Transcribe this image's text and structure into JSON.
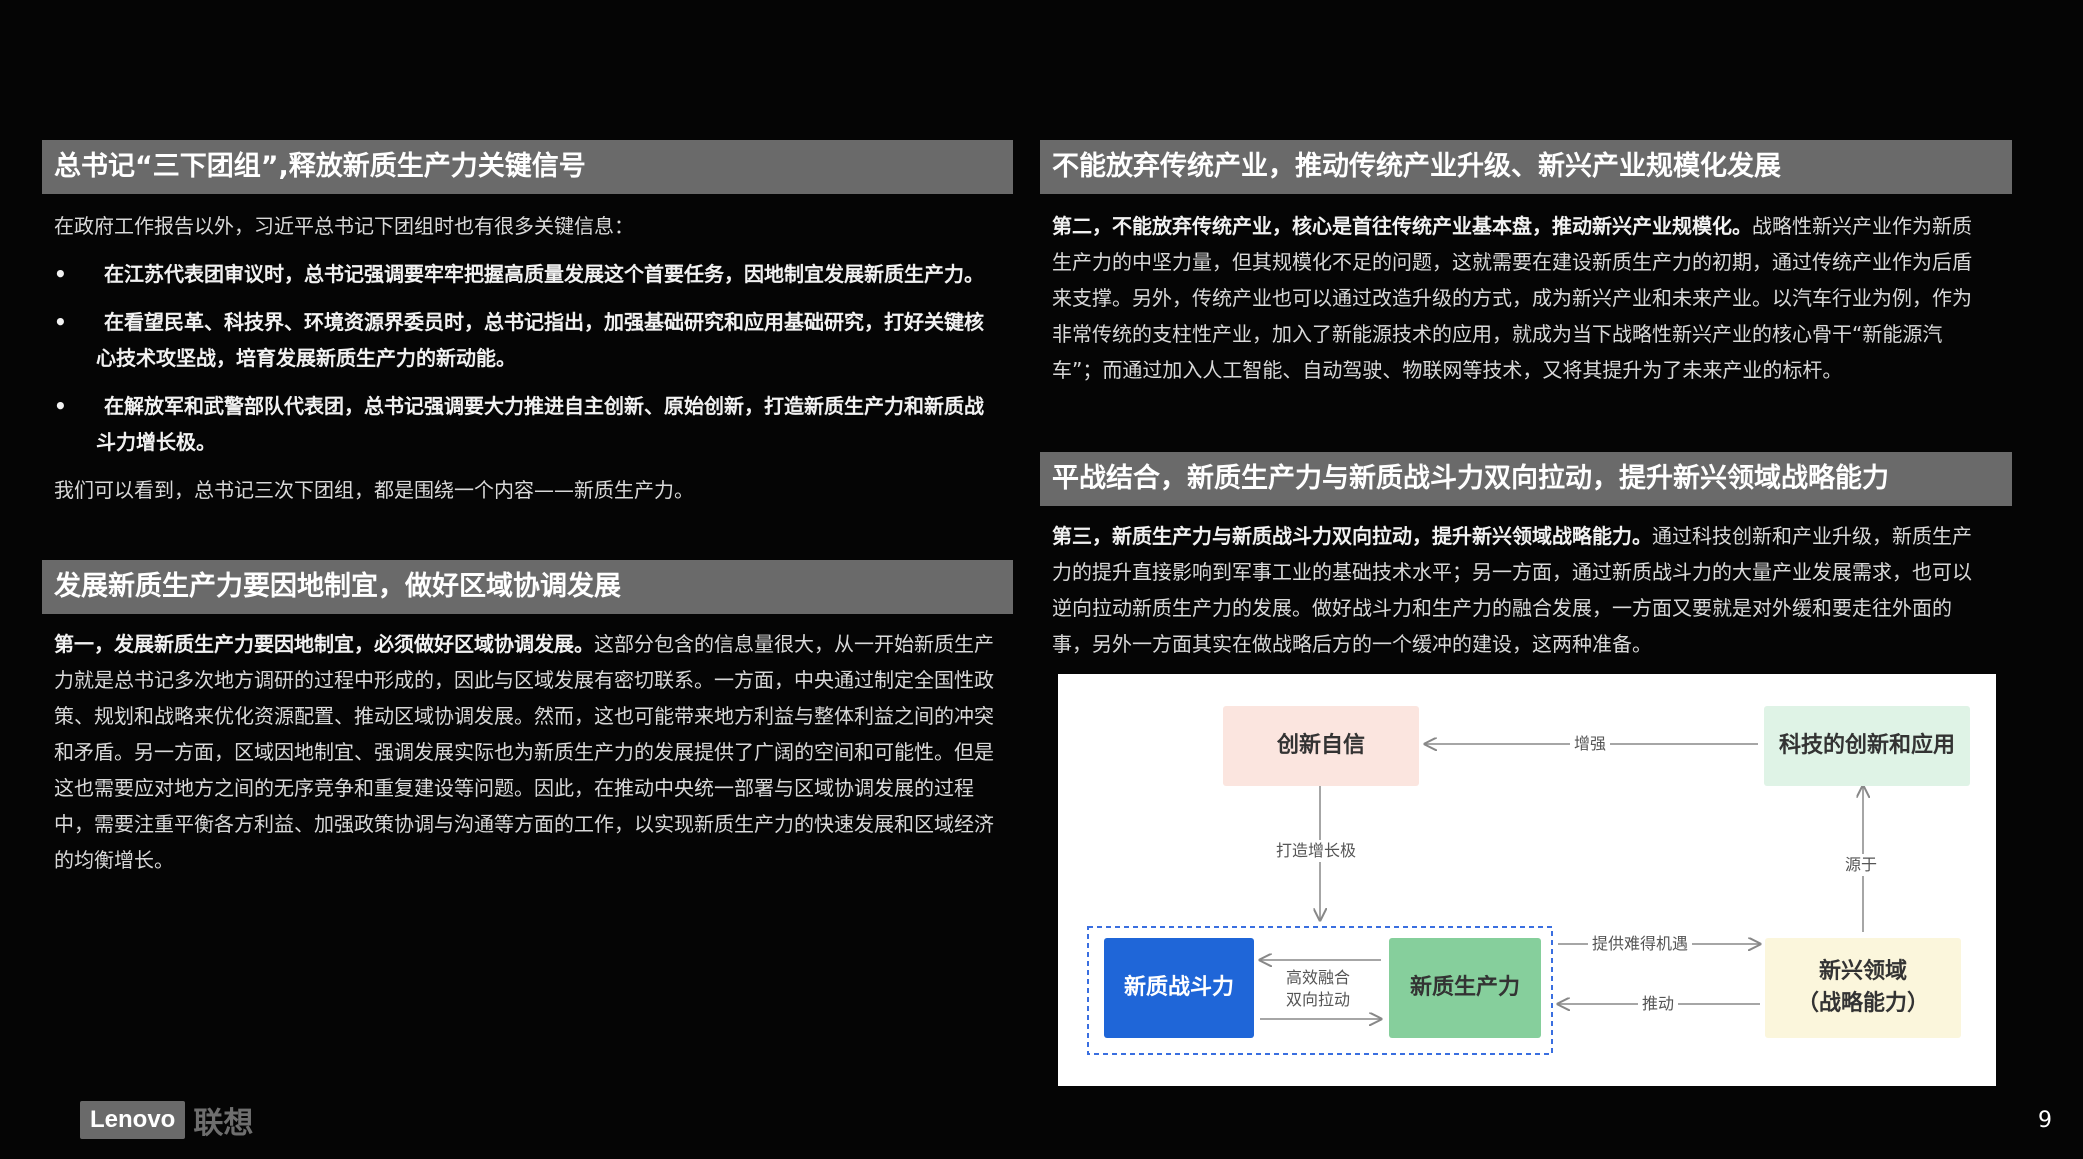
{
  "left_top": {
    "title": "总书记“三下团组”,释放新质生产力关键信号",
    "intro": "在政府工作报告以外，习近平总书记下团组时也有很多关键信息：",
    "bullets": [
      "在江苏代表团审议时，总书记强调要牢牢把握高质量发展这个首要任务，因地制宜发展新质生产力。",
      "在看望民革、科技界、环境资源界委员时，总书记指出，加强基础研究和应用基础研究，打好关键核心技术攻坚战，培育发展新质生产力的新动能。",
      "在解放军和武警部队代表团，总书记强调要大力推进自主创新、原始创新，打造新质生产力和新质战斗力增长极。"
    ],
    "bullet_symbol": "•",
    "conclusion": "我们可以看到，总书记三次下团组，都是围绕一个内容——新质生产力。"
  },
  "left_bottom": {
    "title": "发展新质生产力要因地制宜，做好区域协调发展",
    "lead_bold": "第一，发展新质生产力要因地制宜，必须做好区域协调发展。",
    "body": "这部分包含的信息量很大，从一开始新质生产力就是总书记多次地方调研的过程中形成的，因此与区域发展有密切联系。一方面，中央通过制定全国性政策、规划和战略来优化资源配置、推动区域协调发展。然而，这也可能带来地方利益与整体利益之间的冲突和矛盾。另一方面，区域因地制宜、强调发展实际也为新质生产力的发展提供了广阔的空间和可能性。但是这也需要应对地方之间的无序竞争和重复建设等问题。因此，在推动中央统一部署与区域协调发展的过程中，需要注重平衡各方利益、加强政策协调与沟通等方面的工作，以实现新质生产力的快速发展和区域经济的均衡增长。"
  },
  "right_top": {
    "title": "不能放弃传统产业，推动传统产业升级、新兴产业规模化发展",
    "lead_bold": "第二，不能放弃传统产业，核心是首往传统产业基本盘，推动新兴产业规模化。",
    "body": "战略性新兴产业作为新质生产力的中坚力量，但其规模化不足的问题，这就需要在建设新质生产力的初期，通过传统产业作为后盾来支撑。另外，传统产业也可以通过改造升级的方式，成为新兴产业和未来产业。以汽车行业为例，作为非常传统的支柱性产业，加入了新能源技术的应用，就成为当下战略性新兴产业的核心骨干“新能源汽车”；而通过加入人工智能、自动驾驶、物联网等技术，又将其提升为了未来产业的标杆。"
  },
  "right_bottom": {
    "title": "平战结合，新质生产力与新质战斗力双向拉动，提升新兴领域战略能力",
    "lead_bold": "第三，新质生产力与新质战斗力双向拉动，提升新兴领域战略能力。",
    "body": "通过科技创新和产业升级，新质生产力的提升直接影响到军事工业的基础技术水平；另一方面，通过新质战斗力的大量产业发展需求，也可以逆向拉动新质生产力的发展。做好战斗力和生产力的融合发展，一方面又要就是对外缓和要走往外面的事，另外一方面其实在做战略后方的一个缓冲的建设，这两种准备。"
  },
  "diagram": {
    "nodes": {
      "innovation_confidence": "创新自信",
      "tech_innovation": "科技的创新和应用",
      "new_combat": "新质战斗力",
      "new_productivity": "新质生产力",
      "emerging_line1": "新兴领域",
      "emerging_line2": "（战略能力）"
    },
    "edges": {
      "enhance": "增强",
      "build_growth": "打造增长极",
      "source": "源于",
      "efficient_fusion": "高效融合",
      "bidirectional": "双向拉动",
      "provide_opportunity": "提供难得机遇",
      "drive": "推动"
    },
    "colors": {
      "innovation_confidence_bg": "#fbe5df",
      "tech_innovation_bg": "#dff3e6",
      "new_combat_bg": "#1f66d8",
      "new_productivity_bg": "#86cf9c",
      "emerging_bg": "#fbf6dc",
      "dashed_border": "#3a6fe0"
    }
  },
  "footer": {
    "logo_text": "Lenovo",
    "logo_cn": "联想",
    "page_number": "9"
  }
}
